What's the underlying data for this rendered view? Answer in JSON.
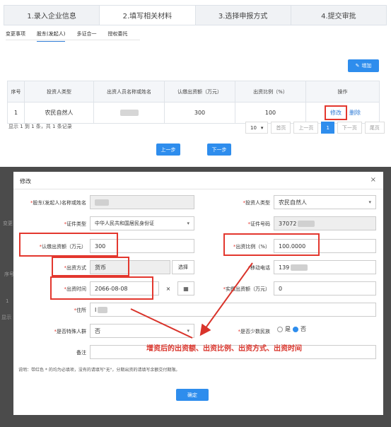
{
  "steps": [
    "1.录入企业信息",
    "2.填写相关材料",
    "3.选择申报方式",
    "4.提交审批"
  ],
  "subtabs": [
    "变更事项",
    "股东(发起人)",
    "多证合一",
    "授权委托"
  ],
  "add_button": "增加",
  "table": {
    "headers": [
      "序号",
      "投资人类型",
      "出资人员名称或姓名",
      "认缴出资额（万元）",
      "出资比例（%）",
      "操作"
    ],
    "row": {
      "index": "1",
      "type": "农民自然人",
      "amount": "300",
      "ratio": "100",
      "edit": "修改",
      "delete": "删除"
    }
  },
  "page_info": "显示 1 到 1 条，共 1 条记录",
  "pager": {
    "size": "10",
    "first": "首页",
    "prev": "上一页",
    "current": "1",
    "next": "下一页",
    "last": "尾页"
  },
  "nav": {
    "prev": "上一步",
    "next": "下一步"
  },
  "ghost": {
    "left_tab": "变更",
    "seq": "序号",
    "idx": "1",
    "info": "显示"
  },
  "modal": {
    "title": "修改",
    "close": "×",
    "labels": {
      "name": "股东(发起人)名称或姓名",
      "investor_type": "投资人类型",
      "id_type": "证件类型",
      "id_no": "证件号码",
      "amount": "认缴出资额（万元）",
      "ratio": "出资比例（%）",
      "method": "出资方式",
      "phone": "移动电话",
      "time": "出资时间",
      "paid": "实缴出资额（万元）",
      "address": "住所",
      "special": "是否特殊人群",
      "minority": "是否少数民族",
      "remark": "备注"
    },
    "values": {
      "investor_type": "农民自然人",
      "id_type": "中华人民共和国居民身份证",
      "id_no": "37072",
      "amount": "300",
      "ratio": "100.0000",
      "method": "货币",
      "choose": "选择",
      "phone": "139",
      "time": "2066-08-08",
      "clear": "×",
      "paid": "0",
      "address": "I",
      "special": "否",
      "yes": "是",
      "no": "否"
    },
    "annotation": "增资后的出资额、出资比例、出资方式、出资时间",
    "note": "说明：带红色 * 的均为必填项，没有的请填写\"无\"，分期出资的请填写余额交付期限。",
    "confirm": "确定"
  },
  "colors": {
    "accent": "#2e8ded",
    "highlight": "#e3372e",
    "annotation": "#d9342b"
  }
}
